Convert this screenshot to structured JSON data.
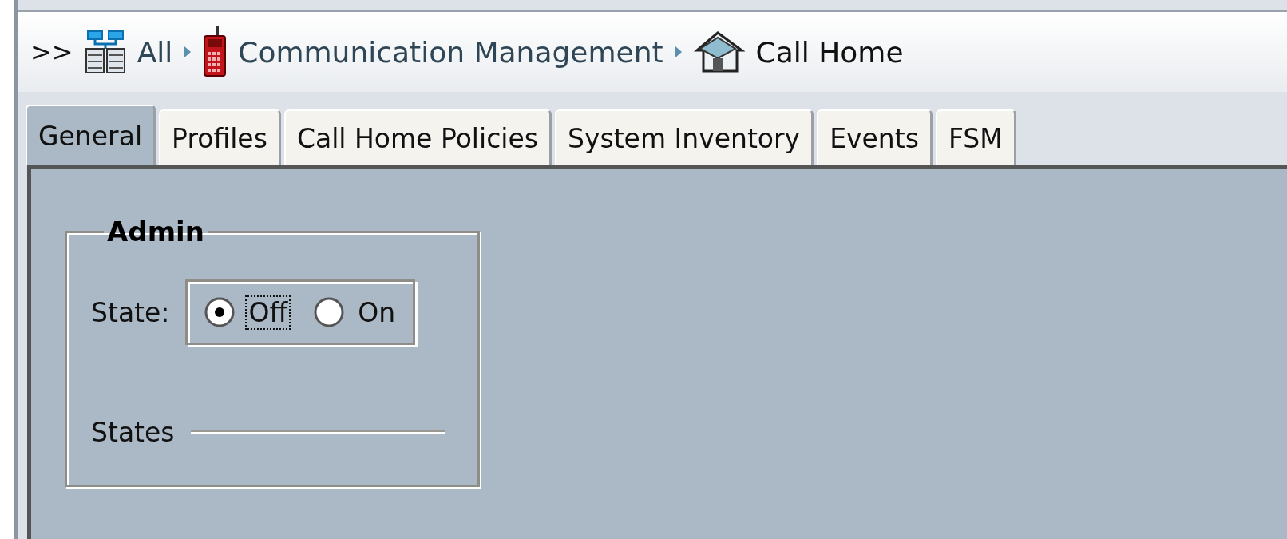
{
  "breadcrumb": {
    "prefix": ">>",
    "items": [
      {
        "label": "All"
      },
      {
        "label": "Communication Management"
      },
      {
        "label": "Call Home"
      }
    ]
  },
  "tabs": [
    {
      "label": "General",
      "selected": true
    },
    {
      "label": "Profiles",
      "selected": false
    },
    {
      "label": "Call Home Policies",
      "selected": false
    },
    {
      "label": "System Inventory",
      "selected": false
    },
    {
      "label": "Events",
      "selected": false
    },
    {
      "label": "FSM",
      "selected": false
    }
  ],
  "admin": {
    "title": "Admin",
    "state_label": "State:",
    "options": [
      {
        "label": "Off",
        "selected": true,
        "focused": true
      },
      {
        "label": "On",
        "selected": false,
        "focused": false
      }
    ],
    "states_label": "States"
  }
}
